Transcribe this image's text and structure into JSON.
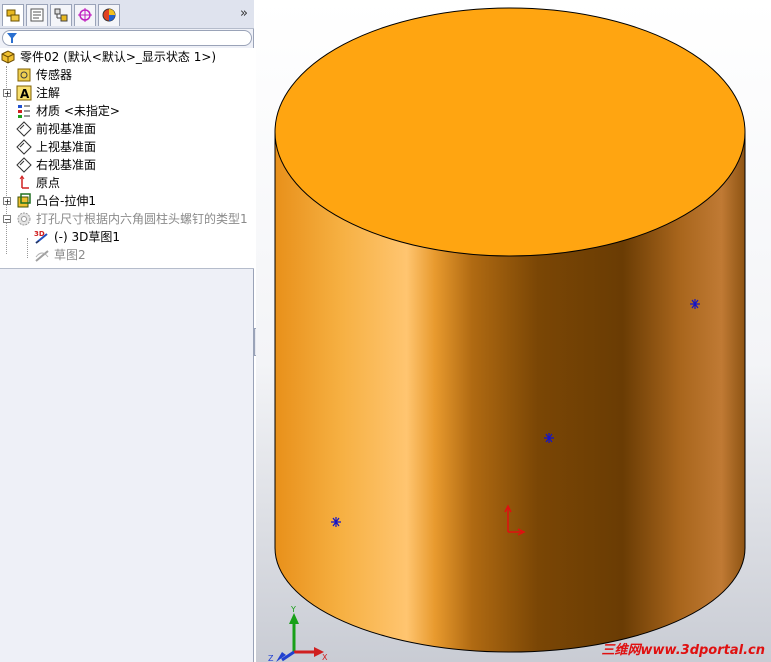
{
  "tabs": [
    {
      "name": "featuremanager",
      "icon": "feature-tree-icon",
      "active": true
    },
    {
      "name": "propertymanager",
      "icon": "property-icon"
    },
    {
      "name": "configurationmanager",
      "icon": "configuration-icon"
    },
    {
      "name": "dimxpert",
      "icon": "dimxpert-icon"
    },
    {
      "name": "display",
      "icon": "display-pane-icon"
    }
  ],
  "tabbar": {
    "more": "»"
  },
  "filter": {
    "icon": "filter-funnel-icon"
  },
  "tree": {
    "root": {
      "label": "零件02  (默认<默认>_显示状态 1>)",
      "icon": "part-icon"
    },
    "items": [
      {
        "label": "传感器",
        "icon": "sensor-icon"
      },
      {
        "label": "注解",
        "icon": "annotation-icon"
      },
      {
        "label": "材质 <未指定>",
        "icon": "material-icon"
      },
      {
        "label": "前视基准面",
        "icon": "plane-icon"
      },
      {
        "label": "上视基准面",
        "icon": "plane-icon"
      },
      {
        "label": "右视基准面",
        "icon": "plane-icon"
      },
      {
        "label": "原点",
        "icon": "origin-icon"
      },
      {
        "label": "凸台-拉伸1",
        "icon": "extrude-icon"
      },
      {
        "label": "打孔尺寸根据内六角圆柱头螺钉的类型1",
        "icon": "hole-wizard-icon"
      },
      {
        "label": "(-) 3D草图1",
        "icon": "3d-sketch-icon"
      },
      {
        "label": "草图2",
        "icon": "sketch-icon"
      }
    ]
  },
  "triad": {
    "x": "X",
    "y": "Y",
    "z": "Z"
  },
  "colors": {
    "body": "#f39f1a",
    "top_face": "#ffa511",
    "point": "#1414c8",
    "origin": "#e01010"
  },
  "watermark": "三维网www.3dportal.cn"
}
